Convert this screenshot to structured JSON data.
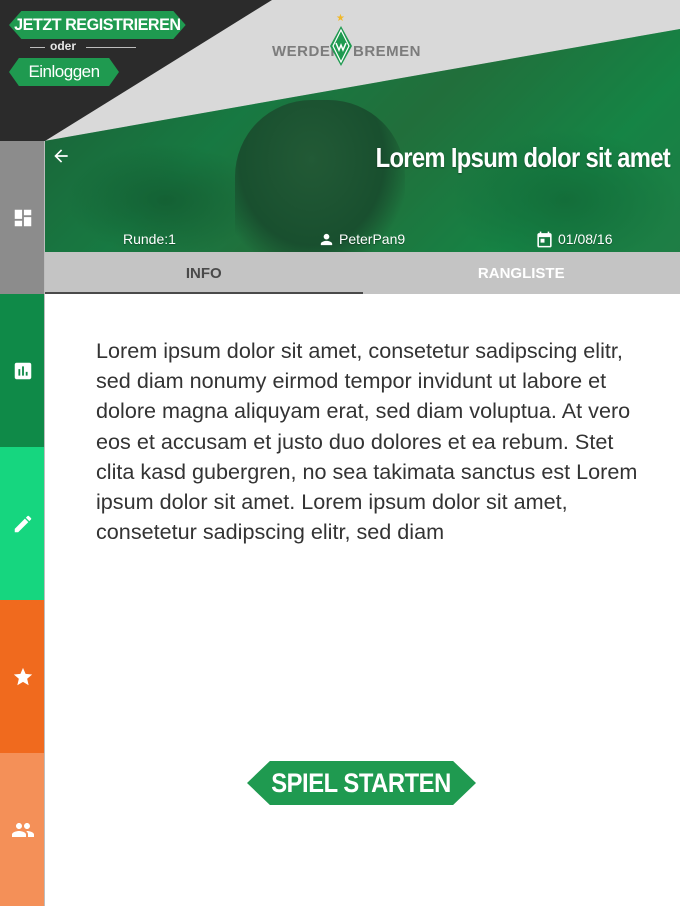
{
  "header": {
    "register_label": "JETZT REGISTRIEREN",
    "or_label": "oder",
    "login_label": "Einloggen",
    "logo_left": "WERDER",
    "logo_right": "BREMEN"
  },
  "hero": {
    "title": "Lorem Ipsum dolor sit amet",
    "round": "Runde:1",
    "user": "PeterPan9",
    "date": "01/08/16"
  },
  "tabs": [
    {
      "label": "INFO",
      "active": true
    },
    {
      "label": "RANGLISTE",
      "active": false
    }
  ],
  "content": {
    "body": "Lorem ipsum dolor sit amet, consetetur sadipscing elitr, sed diam nonumy eirmod tempor invidunt ut labore et dolore magna aliquyam erat, sed diam voluptua. At vero eos et accusam et justo duo dolores et ea rebum. Stet clita kasd gubergren, no sea takimata sanctus est Lorem ipsum dolor sit amet. Lorem ipsum dolor sit amet, consetetur sadipscing elitr, sed diam"
  },
  "start_button": "SPIEL STARTEN",
  "sidebar": {
    "items": [
      {
        "icon": "dashboard-icon",
        "color": "#8c8c8c"
      },
      {
        "icon": "bar-chart-icon",
        "color": "#0f8a48"
      },
      {
        "icon": "pencil-icon",
        "color": "#16d67f"
      },
      {
        "icon": "star-icon",
        "color": "#f06a1e"
      },
      {
        "icon": "people-icon",
        "color": "#f49058"
      }
    ]
  },
  "colors": {
    "brand_green": "#1f9a50",
    "tab_bar": "#c4c4c4",
    "header_dark": "#2b2b2b",
    "header_light": "#d9d9d9"
  }
}
